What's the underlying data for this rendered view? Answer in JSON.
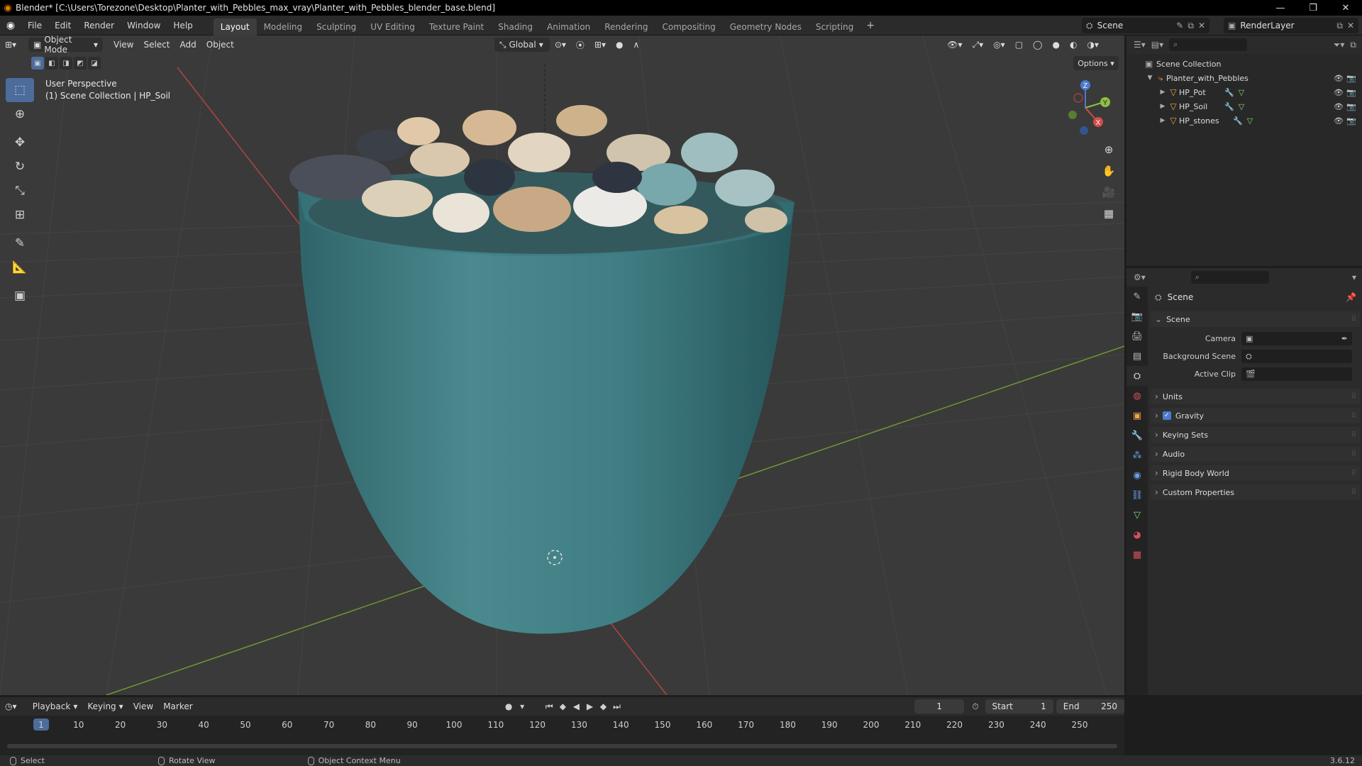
{
  "window": {
    "title": "Blender* [C:\\Users\\Torezone\\Desktop\\Planter_with_Pebbles_max_vray\\Planter_with_Pebbles_blender_base.blend]",
    "controls": [
      "—",
      "❐",
      "✕"
    ]
  },
  "menu": [
    "File",
    "Edit",
    "Render",
    "Window",
    "Help"
  ],
  "workspaces": [
    "Layout",
    "Modeling",
    "Sculpting",
    "UV Editing",
    "Texture Paint",
    "Shading",
    "Animation",
    "Rendering",
    "Compositing",
    "Geometry Nodes",
    "Scripting"
  ],
  "active_workspace": "Layout",
  "scene_name": "Scene",
  "render_layer": "RenderLayer",
  "viewport": {
    "mode": "Object Mode",
    "menus": [
      "View",
      "Select",
      "Add",
      "Object"
    ],
    "orientation": "Global",
    "options_label": "Options",
    "perspective": "User Perspective",
    "collection_info": "(1) Scene Collection | HP_Soil",
    "gizmo_axes": {
      "x": "X",
      "y": "Y",
      "z": "Z"
    }
  },
  "outliner": {
    "root": "Scene Collection",
    "collection": "Planter_with_Pebbles",
    "objects": [
      "HP_Pot",
      "HP_Soil",
      "HP_stones"
    ]
  },
  "properties": {
    "context_title": "Scene",
    "section": "Scene",
    "fields": [
      {
        "label": "Camera",
        "value": ""
      },
      {
        "label": "Background Scene",
        "value": ""
      },
      {
        "label": "Active Clip",
        "value": ""
      }
    ],
    "panels": [
      "Units",
      "Gravity",
      "Keying Sets",
      "Audio",
      "Rigid Body World",
      "Custom Properties"
    ],
    "gravity_enabled": true
  },
  "timeline": {
    "menus": [
      "Playback",
      "Keying",
      "View",
      "Marker"
    ],
    "current_frame": "1",
    "start_label": "Start",
    "start_value": "1",
    "end_label": "End",
    "end_value": "250",
    "ruler_labels": [
      "1",
      "10",
      "20",
      "30",
      "40",
      "50",
      "60",
      "70",
      "80",
      "90",
      "100",
      "110",
      "120",
      "130",
      "140",
      "150",
      "160",
      "170",
      "180",
      "190",
      "200",
      "210",
      "220",
      "230",
      "240",
      "250"
    ]
  },
  "statusbar": {
    "select": "Select",
    "rotate": "Rotate View",
    "context_menu": "Object Context Menu",
    "version": "3.6.12"
  },
  "colors": {
    "accent": "#4c6c9b",
    "pot": "#3f7e83",
    "axis_x": "#c24a4a",
    "axis_y": "#7aa63a"
  }
}
